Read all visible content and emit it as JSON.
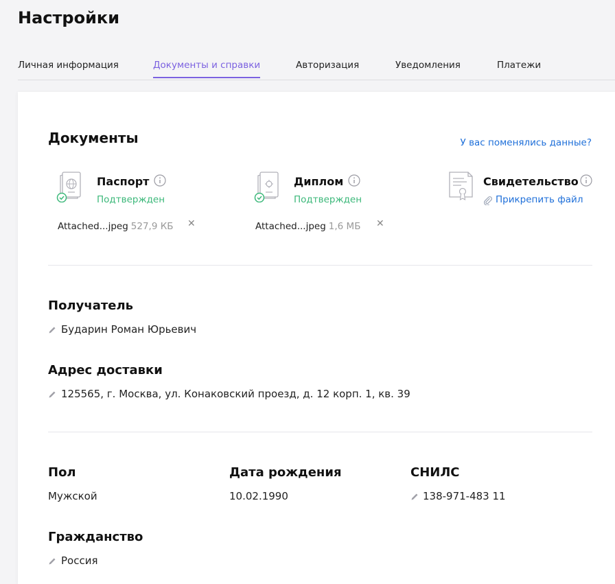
{
  "page": {
    "title": "Настройки"
  },
  "tabs": [
    {
      "label": "Личная информация"
    },
    {
      "label": "Документы и справки"
    },
    {
      "label": "Авторизация"
    },
    {
      "label": "Уведомления"
    },
    {
      "label": "Платежи"
    }
  ],
  "active_tab": "Документы и справки",
  "documents": {
    "title": "Документы",
    "change_link": "У вас поменялись данные?",
    "items": [
      {
        "name": "Паспорт",
        "status": "Подтвержден",
        "file_name": "Attached...jpeg",
        "file_size": "527,9 КБ",
        "icon": "passport-icon"
      },
      {
        "name": "Диплом",
        "status": "Подтвержден",
        "file_name": "Attached...jpeg",
        "file_size": "1,6 МБ",
        "icon": "diploma-icon"
      },
      {
        "name": "Свидетельство",
        "attach_label": "Прикрепить файл",
        "icon": "certificate-icon"
      }
    ]
  },
  "recipient": {
    "label": "Получатель",
    "value": "Бударин Роман Юрьевич"
  },
  "delivery_address": {
    "label": "Адрес доставки",
    "value": "125565, г. Москва, ул. Конаковский проезд, д. 12 корп. 1, кв. 39"
  },
  "gender": {
    "label": "Пол",
    "value": "Мужской"
  },
  "birth_date": {
    "label": "Дата рождения",
    "value": "10.02.1990"
  },
  "snils": {
    "label": "СНИЛС",
    "value": "138-971-483 11"
  },
  "citizenship": {
    "label": "Гражданство",
    "value": "Россия"
  },
  "colors": {
    "accent": "#7b61e0",
    "link": "#1e6fd9",
    "success": "#3cb87a"
  }
}
